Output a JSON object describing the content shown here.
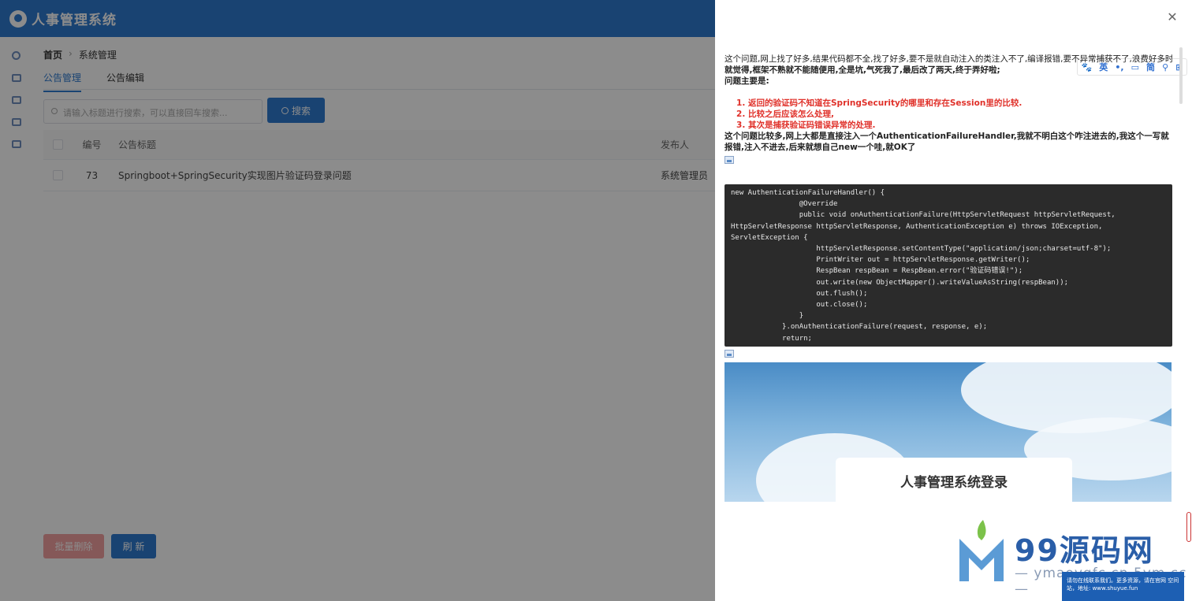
{
  "app": {
    "title": "人事管理系统",
    "breadcrumb": {
      "home": "首页",
      "current": "系统管理"
    },
    "tabs": [
      "公告管理",
      "公告编辑"
    ],
    "search": {
      "placeholder": "请输入标题进行搜索，可以直接回车搜索...",
      "button": "搜索"
    },
    "table": {
      "headers": {
        "id": "编号",
        "title": "公告标题",
        "author": "发布人"
      },
      "rows": [
        {
          "id": "73",
          "title": "Springboot+SpringSecurity实现图片验证码登录问题",
          "author": "系统管理员"
        }
      ]
    },
    "buttons": {
      "batch_delete": "批量删除",
      "refresh": "刷 新"
    }
  },
  "drawer": {
    "intro": "这个问题,网上找了好多,结果代码都不全,找了好多,要不是就自动注入的类注入不了,编译报错,要不异常捕获不了,浪费好多时间",
    "intro2": "就觉得,框架不熟就不能随便用,全是坑,气死我了,最后改了两天,终于弄好啦;",
    "issues_title": "问题主要是:",
    "issues": [
      "返回的验证码不知道在SpringSecurity的哪里和存在Session里的比较.",
      "比较之后应该怎么处理,",
      "其次是捕获验证码错误异常的处理."
    ],
    "summary": "这个问题比较多,网上大都是直接注入一个AuthenticationFailureHandler,我就不明白这个咋注进去的,我这个一写就报错,注入不进去,后来就想自己new一个哇,就OK了",
    "code": "new AuthenticationFailureHandler() {\n                @Override\n                public void onAuthenticationFailure(HttpServletRequest httpServletRequest,\nHttpServletResponse httpServletResponse, AuthenticationException e) throws IOException,\nServletException {\n                    httpServletResponse.setContentType(\"application/json;charset=utf-8\");\n                    PrintWriter out = httpServletResponse.getWriter();\n                    RespBean respBean = RespBean.error(\"验证码错误!\");\n                    out.write(new ObjectMapper().writeValueAsString(respBean));\n                    out.flush();\n                    out.close();\n                }\n            }.onAuthenticationFailure(request, response, e);\n            return;",
    "login_card_title": "人事管理系统登录",
    "translator": [
      "🐾",
      "英",
      "•,",
      "▭",
      "简",
      "⚲",
      "⊞"
    ]
  },
  "watermark": {
    "brand": "99源码网",
    "url": "— ymaovgfc.cn 5ym.cc —",
    "notice": "请勿在线联系我们。更多资源，请在官网 空间站，地址: www.shuyue.fun"
  }
}
